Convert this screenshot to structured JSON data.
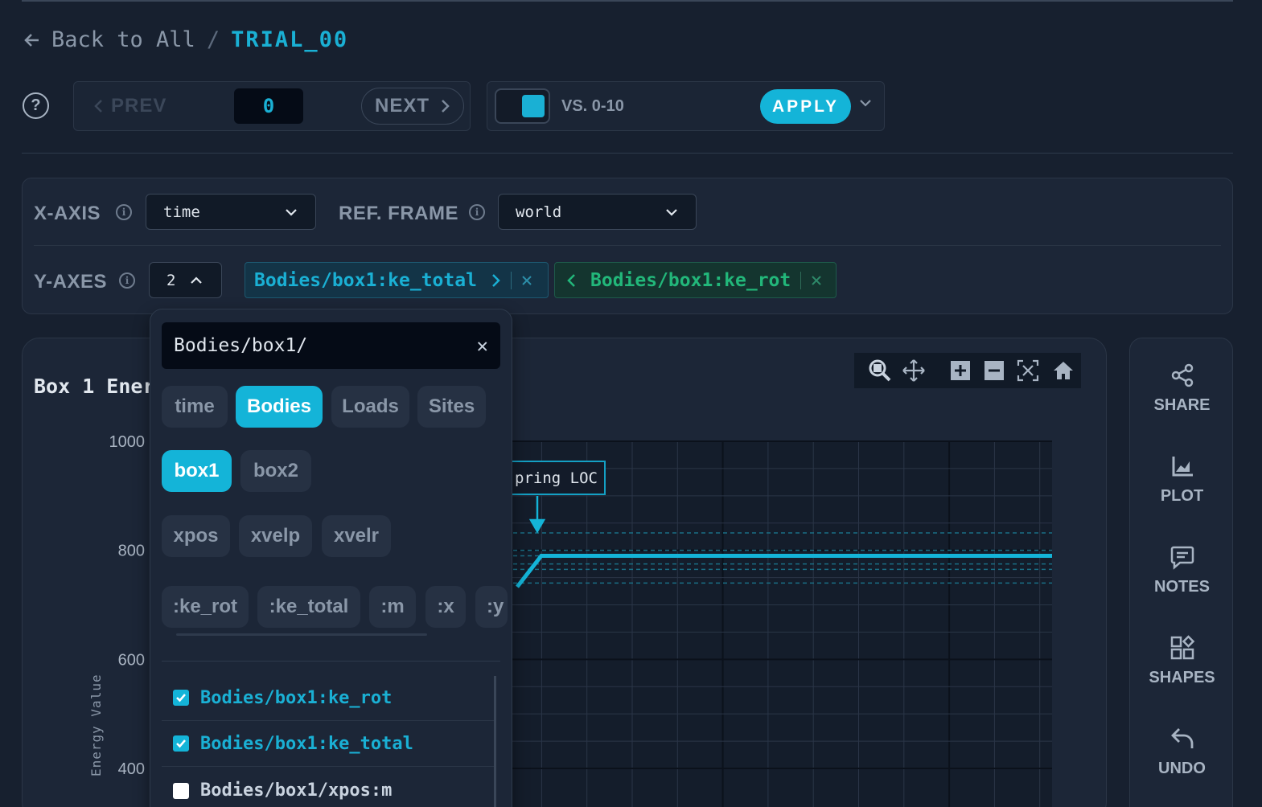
{
  "breadcrumb": {
    "back_label": "Back to All",
    "separator": "/",
    "current": "TRIAL_00"
  },
  "nav": {
    "prev_label": "PREV",
    "frame_value": "0",
    "next_label": "NEXT"
  },
  "compare": {
    "vs_label": "VS. 0-10",
    "apply_label": "APPLY",
    "toggle_on": true
  },
  "axes": {
    "x_axis_label": "X-AXIS",
    "x_axis_value": "time",
    "ref_frame_label": "REF. FRAME",
    "ref_frame_value": "world",
    "y_axes_label": "Y-AXES",
    "y_axes_count": "2",
    "y_chips": [
      {
        "label": "Bodies/box1:ke_total",
        "color": "#1ab0d4"
      },
      {
        "label": "Bodies/box1:ke_rot",
        "color": "#22b77a"
      }
    ]
  },
  "picker": {
    "search_value": "Bodies/box1/",
    "categories": [
      "time",
      "Bodies",
      "Loads",
      "Sites"
    ],
    "active_category": "Bodies",
    "bodies": [
      "box1",
      "box2"
    ],
    "active_body": "box1",
    "fields": [
      "xpos",
      "xvelp",
      "xvelr"
    ],
    "attributes": [
      ":ke_rot",
      ":ke_total",
      ":m",
      ":x",
      ":y"
    ],
    "results": [
      {
        "label": "Bodies/box1:ke_rot",
        "checked": true
      },
      {
        "label": "Bodies/box1:ke_total",
        "checked": true
      },
      {
        "label": "Bodies/box1/xpos:m",
        "checked": false
      }
    ]
  },
  "chart": {
    "title": "Box 1 Ener",
    "annotation": "pring LOC",
    "y_axis_label": "Energy Value",
    "toolbar": [
      "zoom-icon",
      "pan-icon",
      "zoom-in-icon",
      "zoom-out-icon",
      "autoscale-icon",
      "home-icon"
    ]
  },
  "chart_data": {
    "type": "line",
    "ylabel": "Energy Value",
    "ylim": [
      400,
      1000
    ],
    "y_ticks": [
      1000,
      800,
      600,
      400
    ],
    "series": [
      {
        "values": [
          758,
          815,
          815,
          815,
          815,
          815
        ],
        "color": "#14b4d8"
      }
    ],
    "grid": true
  },
  "sidebar": {
    "share": "SHARE",
    "plot": "PLOT",
    "notes": "NOTES",
    "shapes": "SHAPES",
    "undo": "UNDO"
  },
  "colors": {
    "accent": "#14b4d8",
    "green": "#22b77a",
    "background": "#17202f"
  }
}
